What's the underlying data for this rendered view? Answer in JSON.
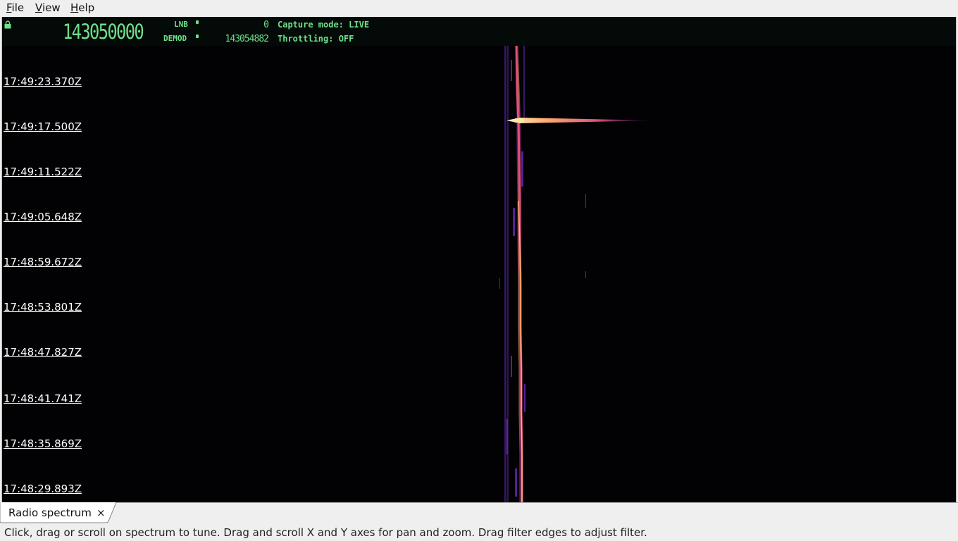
{
  "menu": {
    "file": {
      "mnemonic": "F",
      "rest": "ile"
    },
    "view": {
      "mnemonic": "V",
      "rest": "iew"
    },
    "help": {
      "mnemonic": "H",
      "rest": "elp"
    }
  },
  "header": {
    "main_frequency": "143050000",
    "lnb_label": "LNB",
    "lnb_value": "0",
    "demod_label": "DEMOD",
    "demod_value": "143054882",
    "capture_mode": "Capture mode: LIVE",
    "throttling": "Throttling: OFF"
  },
  "waterfall": {
    "timestamps": [
      "17:49:23.370Z",
      "17:49:17.500Z",
      "17:49:11.522Z",
      "17:49:05.648Z",
      "17:48:59.672Z",
      "17:48:53.801Z",
      "17:48:47.827Z",
      "17:48:41.741Z",
      "17:48:35.869Z",
      "17:48:29.893Z"
    ]
  },
  "tab": {
    "label": "Radio spectrum",
    "close_glyph": "×"
  },
  "statusbar": {
    "text": "Click, drag or scroll on spectrum to tune. Drag and scroll X and Y axes for pan and zoom. Drag filter edges to adjust filter."
  },
  "colors": {
    "header_green": "#6ee08c",
    "hot": "#ffb070",
    "warm": "#e0507a",
    "cool": "#7a2ac0"
  }
}
